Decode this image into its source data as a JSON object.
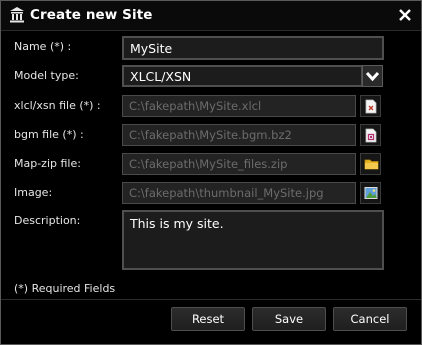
{
  "dialog": {
    "title": "Create new Site",
    "title_icon": "building-icon",
    "close_icon": "close-icon"
  },
  "form": {
    "name": {
      "label": "Name (*) :",
      "value": "MySite"
    },
    "model_type": {
      "label": "Model type:",
      "value": "XLCL/XSN"
    },
    "xlcl_file": {
      "label": "xlcl/xsn file (*) :",
      "value": "C:\\fakepath\\MySite.xlcl",
      "icon": "xlcl-file-icon"
    },
    "bgm_file": {
      "label": "bgm file (*) :",
      "value": "C:\\fakepath\\MySite.bgm.bz2",
      "icon": "bgm-file-icon"
    },
    "map_zip": {
      "label": "Map-zip file:",
      "value": "C:\\fakepath\\MySite_files.zip",
      "icon": "folder-icon"
    },
    "image": {
      "label": "Image:",
      "value": "C:\\fakepath\\thumbnail_MySite.jpg",
      "icon": "image-icon"
    },
    "description": {
      "label": "Description:",
      "value": "This is my site."
    }
  },
  "required_note": "(*) Required Fields",
  "buttons": {
    "reset": "Reset",
    "save": "Save",
    "cancel": "Cancel"
  },
  "colors": {
    "background": "#000000",
    "field_bg": "#1e1e1e",
    "border": "#5b5b5b",
    "text": "#ffffff",
    "disabled_text": "#6c6c6c"
  }
}
